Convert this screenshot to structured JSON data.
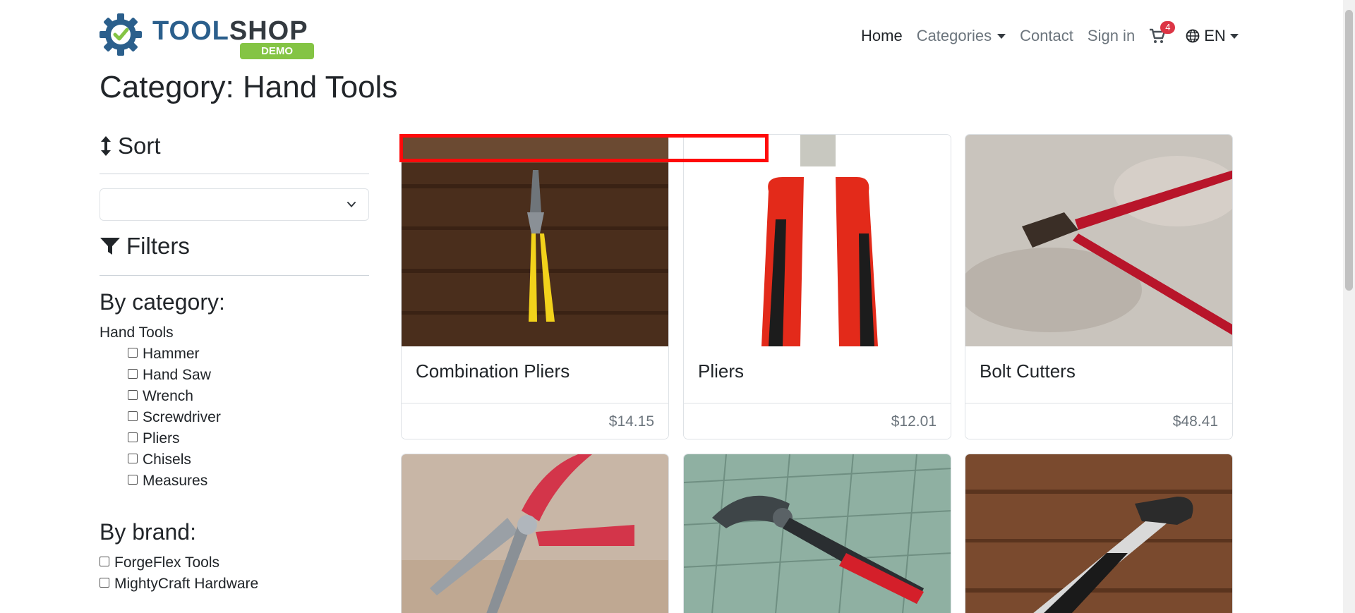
{
  "header": {
    "logo_main": "TOOL",
    "logo_accent": "SHOP",
    "logo_badge": "DEMO",
    "nav": {
      "home": "Home",
      "categories": "Categories",
      "contact": "Contact",
      "sign_in": "Sign in",
      "cart_count": "4",
      "language": "EN"
    }
  },
  "page_title": "Category: Hand Tools",
  "sidebar": {
    "sort_heading": "Sort",
    "sort_value": "",
    "filters_heading": "Filters",
    "by_category": "By category:",
    "category_parent": "Hand Tools",
    "categories": [
      "Hammer",
      "Hand Saw",
      "Wrench",
      "Screwdriver",
      "Pliers",
      "Chisels",
      "Measures"
    ],
    "by_brand": "By brand:",
    "brands": [
      "ForgeFlex Tools",
      "MightyCraft Hardware"
    ]
  },
  "products": [
    {
      "name": "Combination Pliers",
      "price": "$14.15"
    },
    {
      "name": "Pliers",
      "price": "$12.01"
    },
    {
      "name": "Bolt Cutters",
      "price": "$48.41"
    },
    {
      "name": "",
      "price": ""
    },
    {
      "name": "",
      "price": ""
    },
    {
      "name": "",
      "price": ""
    }
  ],
  "colors": {
    "highlight": "#ff0a0a",
    "brand_blue": "#2b5f8c",
    "badge_green": "#84c444",
    "cart_badge": "#dc3545"
  }
}
